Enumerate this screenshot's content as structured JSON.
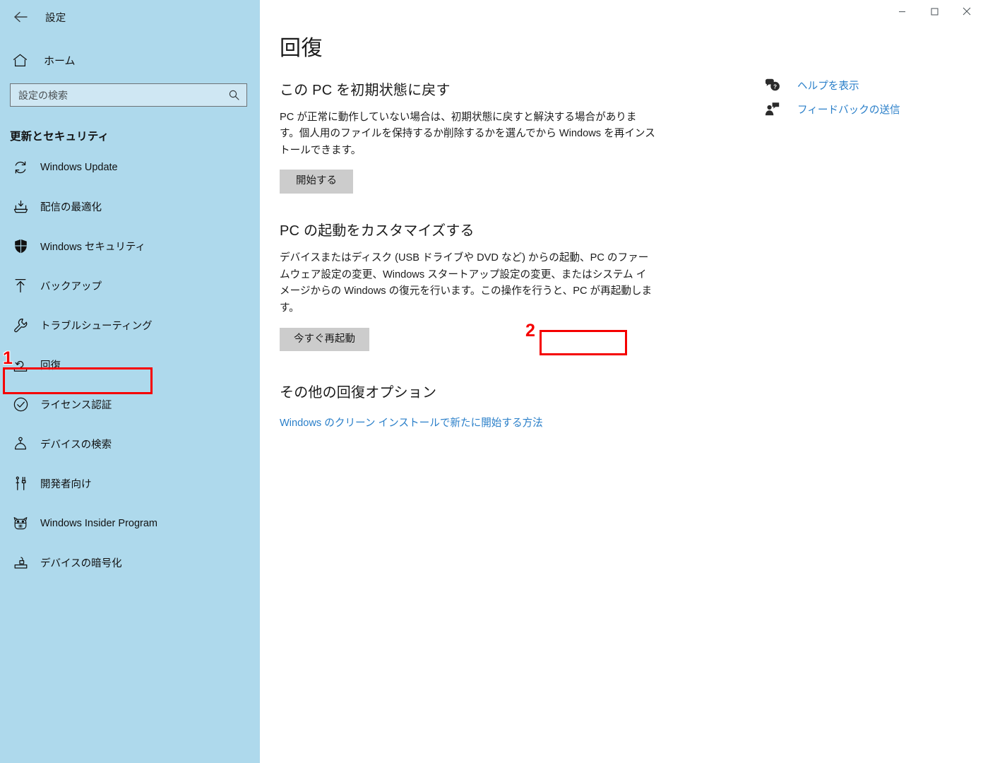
{
  "window": {
    "app_title": "設定",
    "back_icon": "back-arrow-icon",
    "controls": {
      "minimize": "minimize-icon",
      "maximize": "maximize-icon",
      "close": "close-icon"
    }
  },
  "sidebar": {
    "home": {
      "label": "ホーム",
      "icon": "home-icon"
    },
    "search": {
      "value": "",
      "placeholder": "設定の検索",
      "icon": "search-icon"
    },
    "section_header": "更新とセキュリティ",
    "items": [
      {
        "label": "Windows Update",
        "icon": "sync-refresh-icon",
        "selected": false
      },
      {
        "label": "配信の最適化",
        "icon": "delivery-optimization-icon",
        "selected": false
      },
      {
        "label": "Windows セキュリティ",
        "icon": "shield-icon",
        "selected": false
      },
      {
        "label": "バックアップ",
        "icon": "upload-arrow-icon",
        "selected": false
      },
      {
        "label": "トラブルシューティング",
        "icon": "wrench-icon",
        "selected": false
      },
      {
        "label": "回復",
        "icon": "recovery-icon",
        "selected": true
      },
      {
        "label": "ライセンス認証",
        "icon": "check-circle-icon",
        "selected": false
      },
      {
        "label": "デバイスの検索",
        "icon": "find-device-icon",
        "selected": false
      },
      {
        "label": "開発者向け",
        "icon": "developer-tools-icon",
        "selected": false
      },
      {
        "label": "Windows Insider Program",
        "icon": "ninjacat-icon",
        "selected": false
      },
      {
        "label": "デバイスの暗号化",
        "icon": "device-encryption-lock-icon",
        "selected": false
      }
    ]
  },
  "main": {
    "page_title": "回復",
    "sections": [
      {
        "heading": "この PC を初期状態に戻す",
        "body": "PC が正常に動作していない場合は、初期状態に戻すと解決する場合があります。個人用のファイルを保持するか削除するかを選んでから Windows を再インストールできます。",
        "button": "開始する"
      },
      {
        "heading": "PC の起動をカスタマイズする",
        "body": "デバイスまたはディスク (USB ドライブや DVD など) からの起動、PC のファームウェア設定の変更、Windows スタートアップ設定の変更、またはシステム イメージからの Windows の復元を行います。この操作を行うと、PC が再起動します。",
        "button": "今すぐ再起動"
      },
      {
        "heading": "その他の回復オプション",
        "link": "Windows のクリーン インストールで新たに開始する方法"
      }
    ]
  },
  "right_rail": {
    "items": [
      {
        "label": "ヘルプを表示",
        "icon": "help-question-bubble-icon"
      },
      {
        "label": "フィードバックの送信",
        "icon": "feedback-person-icon"
      }
    ]
  },
  "annotations": [
    {
      "number": "1",
      "target": "sidebar-item-回復"
    },
    {
      "number": "2",
      "target": "restart-now-button"
    }
  ],
  "colors": {
    "sidebar_bg": "#AED9EC",
    "link_blue": "#2A7FC9",
    "button_gray": "#CCCCCC",
    "annotation_red": "#F50000"
  }
}
